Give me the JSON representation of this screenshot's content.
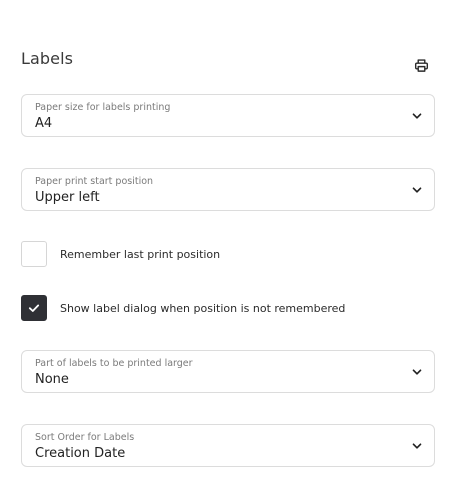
{
  "section": {
    "title": "Labels",
    "print_icon": "printer-icon"
  },
  "fields": {
    "paper_size": {
      "label": "Paper size for labels printing",
      "value": "A4"
    },
    "start_position": {
      "label": "Paper print start position",
      "value": "Upper left"
    },
    "larger_part": {
      "label": "Part of labels to be printed larger",
      "value": "None"
    },
    "sort_order": {
      "label": "Sort Order for Labels",
      "value": "Creation Date"
    }
  },
  "checkboxes": {
    "remember_position": {
      "label": "Remember last print position",
      "checked": false
    },
    "show_dialog": {
      "label": "Show label dialog when position is not remembered",
      "checked": true
    }
  },
  "colors": {
    "checkbox_checked": "#2f3035",
    "border": "#dcdcdc"
  }
}
